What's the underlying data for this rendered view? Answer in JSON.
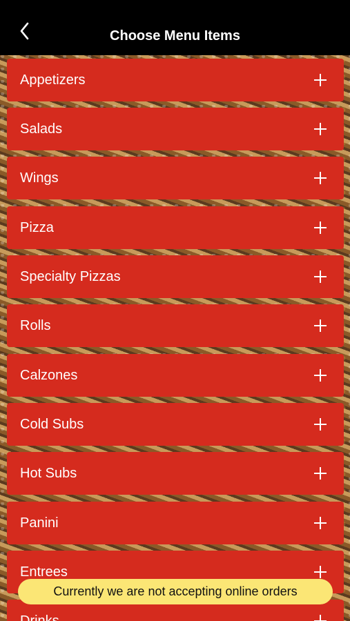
{
  "header": {
    "title": "Choose Menu Items",
    "back_icon": "chevron-left-icon"
  },
  "menu": {
    "items": [
      {
        "label": "Appetizers"
      },
      {
        "label": "Salads"
      },
      {
        "label": "Wings"
      },
      {
        "label": "Pizza"
      },
      {
        "label": "Specialty Pizzas"
      },
      {
        "label": "Rolls"
      },
      {
        "label": "Calzones"
      },
      {
        "label": "Cold Subs"
      },
      {
        "label": "Hot Subs"
      },
      {
        "label": "Panini"
      },
      {
        "label": "Entrees"
      },
      {
        "label": "Drinks"
      }
    ],
    "expand_icon": "plus-icon"
  },
  "banner": {
    "text": "Currently we are not accepting online orders"
  },
  "colors": {
    "header_bg": "#000000",
    "row_bg": "#d52b1e",
    "banner_bg": "#fbe675"
  }
}
